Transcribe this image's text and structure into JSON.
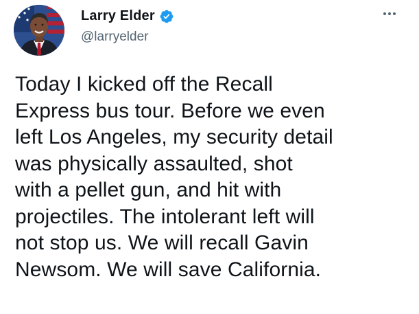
{
  "author": {
    "display_name": "Larry Elder",
    "handle": "@larryelder",
    "verified": true
  },
  "tweet": {
    "text": "Today I kicked off the Recall\nExpress bus tour. Before we even\nleft Los Angeles, my security detail\nwas physically assaulted, shot\nwith a pellet gun, and hit with\nprojectiles. The intolerant left will\nnot stop us. We will recall Gavin\nNewsom. We will save California."
  },
  "icons": {
    "verified": "verified-badge-icon",
    "more": "more-options-icon"
  },
  "colors": {
    "text_primary": "#0f1419",
    "text_secondary": "#536471",
    "verified_blue": "#1d9bf0",
    "background": "#ffffff"
  }
}
